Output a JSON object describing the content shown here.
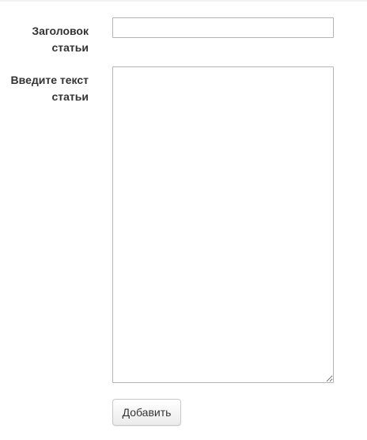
{
  "form": {
    "title_label": "Заголовок статьи",
    "title_value": "",
    "body_label": "Введите текст статьи",
    "body_value": "",
    "submit_label": "Добавить"
  }
}
